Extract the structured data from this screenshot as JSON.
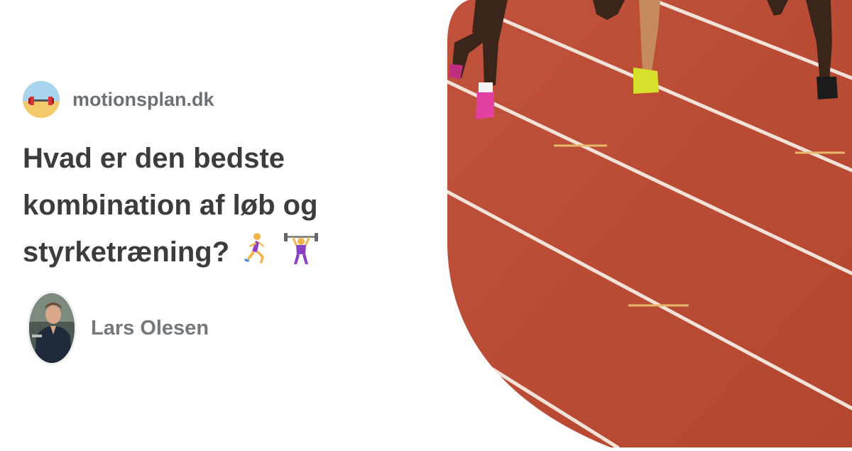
{
  "site": {
    "name": "motionsplan.dk",
    "logo_icon": "dumbbell-icon"
  },
  "article": {
    "title_lines": [
      "Hvad er den bedste",
      "kombination af løb og",
      "styrketræning?"
    ],
    "title_icons": [
      "woman-running-icon",
      "woman-lifting-weights-icon"
    ]
  },
  "author": {
    "name": "Lars Olesen",
    "avatar_icon": "author-photo"
  },
  "hero": {
    "image": "running-track-photo",
    "track_color": "#b9492f",
    "lane_color": "#f6e8e0"
  }
}
